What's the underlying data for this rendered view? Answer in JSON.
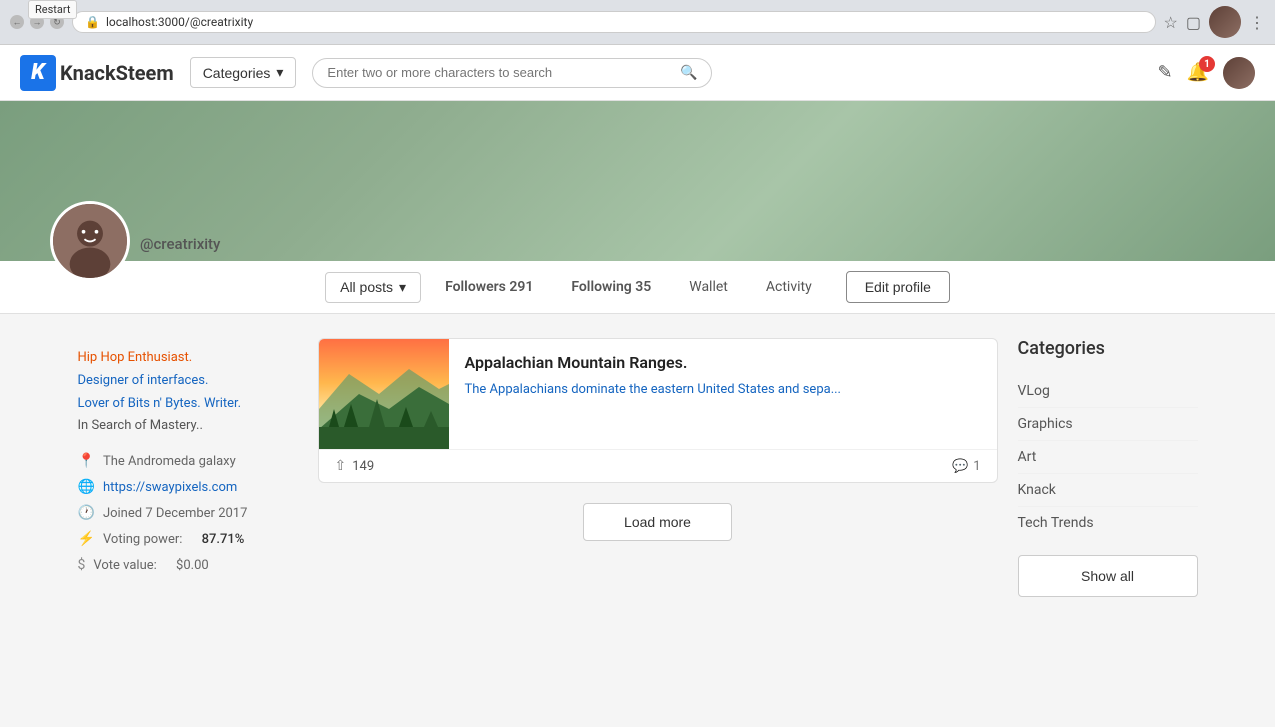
{
  "browser": {
    "url": "localhost:3000/@creatrixity",
    "restart_label": "Restart"
  },
  "navbar": {
    "logo_letter": "K",
    "logo_text_plain": "Knack",
    "logo_text_bold": "Steem",
    "categories_label": "Categories",
    "search_placeholder": "Enter two or more characters to search"
  },
  "notification": {
    "count": "1"
  },
  "profile": {
    "username": "@creatrixity",
    "followers_label": "Followers",
    "followers_count": "291",
    "following_label": "Following",
    "following_count": "35",
    "wallet_label": "Wallet",
    "activity_label": "Activity",
    "edit_profile_label": "Edit profile",
    "all_posts_label": "All posts"
  },
  "sidebar": {
    "bio_line1": "Hip Hop Enthusiast.",
    "bio_line2": "Designer of interfaces.",
    "bio_line3": "Lover of Bits n' Bytes. Writer.",
    "bio_line4": "In Search of Mastery..",
    "location": "The Andromeda galaxy",
    "website": "https://swaypixels.com",
    "joined": "Joined 7 December 2017",
    "voting_power_label": "Voting power:",
    "voting_power_value": "87.71%",
    "vote_value_label": "Vote value:",
    "vote_value_value": "$0.00"
  },
  "post": {
    "title": "Appalachian Mountain Ranges.",
    "excerpt": "The Appalachians dominate the eastern United States and sepa...",
    "votes": "149",
    "comments": "1"
  },
  "feed": {
    "load_more_label": "Load more"
  },
  "categories": {
    "title": "Categories",
    "items": [
      {
        "label": "VLog"
      },
      {
        "label": "Graphics"
      },
      {
        "label": "Art"
      },
      {
        "label": "Knack"
      },
      {
        "label": "Tech Trends"
      }
    ],
    "show_all_label": "Show all"
  }
}
